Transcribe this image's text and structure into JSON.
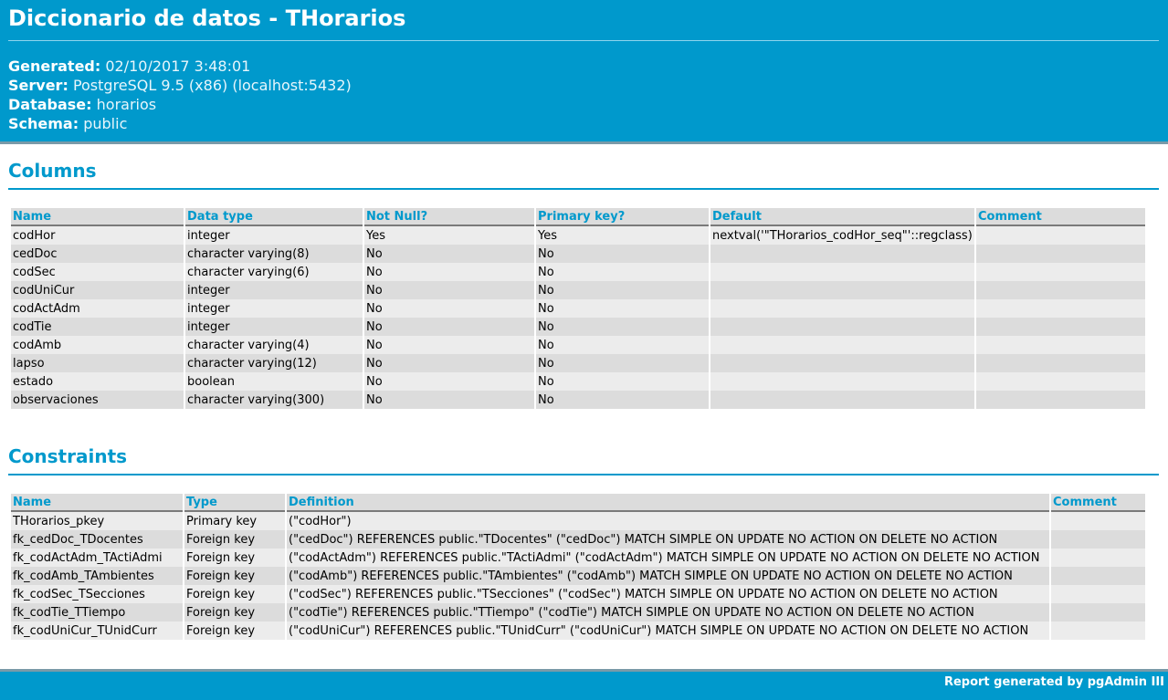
{
  "header": {
    "title": "Diccionario de datos - THorarios",
    "meta": [
      {
        "key": "Generated:",
        "value": "02/10/2017 3:48:01"
      },
      {
        "key": "Server:",
        "value": "PostgreSQL 9.5 (x86) (localhost:5432)"
      },
      {
        "key": "Database:",
        "value": "horarios"
      },
      {
        "key": "Schema:",
        "value": "public"
      }
    ]
  },
  "columns_section": {
    "heading": "Columns",
    "headers": [
      "Name",
      "Data type",
      "Not Null?",
      "Primary key?",
      "Default",
      "Comment"
    ],
    "rows": [
      [
        "codHor",
        "integer",
        "Yes",
        "Yes",
        "nextval('\"THorarios_codHor_seq\"'::regclass)",
        ""
      ],
      [
        "cedDoc",
        "character varying(8)",
        "No",
        "No",
        "",
        ""
      ],
      [
        "codSec",
        "character varying(6)",
        "No",
        "No",
        "",
        ""
      ],
      [
        "codUniCur",
        "integer",
        "No",
        "No",
        "",
        ""
      ],
      [
        "codActAdm",
        "integer",
        "No",
        "No",
        "",
        ""
      ],
      [
        "codTie",
        "integer",
        "No",
        "No",
        "",
        ""
      ],
      [
        "codAmb",
        "character varying(4)",
        "No",
        "No",
        "",
        ""
      ],
      [
        "lapso",
        "character varying(12)",
        "No",
        "No",
        "",
        ""
      ],
      [
        "estado",
        "boolean",
        "No",
        "No",
        "",
        ""
      ],
      [
        "observaciones",
        "character varying(300)",
        "No",
        "No",
        "",
        ""
      ]
    ]
  },
  "constraints_section": {
    "heading": "Constraints",
    "headers": [
      "Name",
      "Type",
      "Definition",
      "Comment"
    ],
    "rows": [
      [
        "THorarios_pkey",
        "Primary key",
        "(\"codHor\")",
        ""
      ],
      [
        "fk_cedDoc_TDocentes",
        "Foreign key",
        "(\"cedDoc\") REFERENCES public.\"TDocentes\" (\"cedDoc\") MATCH SIMPLE ON UPDATE NO ACTION ON DELETE NO ACTION",
        ""
      ],
      [
        "fk_codActAdm_TActiAdmi",
        "Foreign key",
        "(\"codActAdm\") REFERENCES public.\"TActiAdmi\" (\"codActAdm\") MATCH SIMPLE ON UPDATE NO ACTION ON DELETE NO ACTION",
        ""
      ],
      [
        "fk_codAmb_TAmbientes",
        "Foreign key",
        "(\"codAmb\") REFERENCES public.\"TAmbientes\" (\"codAmb\") MATCH SIMPLE ON UPDATE NO ACTION ON DELETE NO ACTION",
        ""
      ],
      [
        "fk_codSec_TSecciones",
        "Foreign key",
        "(\"codSec\") REFERENCES public.\"TSecciones\" (\"codSec\") MATCH SIMPLE ON UPDATE NO ACTION ON DELETE NO ACTION",
        ""
      ],
      [
        "fk_codTie_TTiempo",
        "Foreign key",
        "(\"codTie\") REFERENCES public.\"TTiempo\" (\"codTie\") MATCH SIMPLE ON UPDATE NO ACTION ON DELETE NO ACTION",
        ""
      ],
      [
        "fk_codUniCur_TUnidCurr",
        "Foreign key",
        "(\"codUniCur\") REFERENCES public.\"TUnidCurr\" (\"codUniCur\") MATCH SIMPLE ON UPDATE NO ACTION ON DELETE NO ACTION",
        ""
      ]
    ]
  },
  "footer": {
    "text": "Report generated by pgAdmin III"
  },
  "colors": {
    "accent": "#0099cc",
    "row_light": "#ececec",
    "row_dark": "#dcdcdc"
  }
}
